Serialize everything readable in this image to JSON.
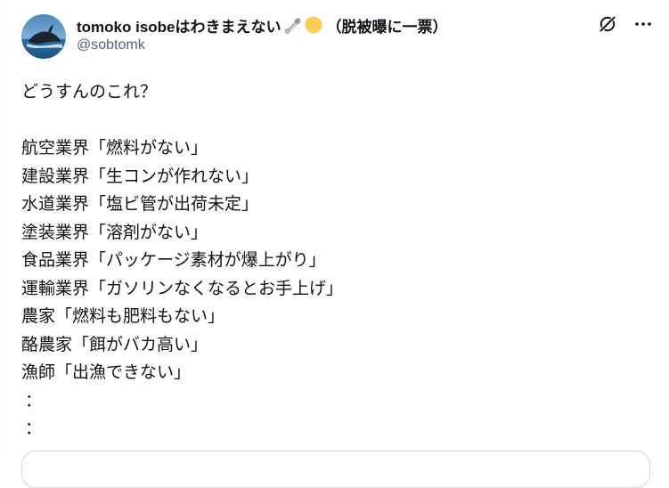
{
  "post": {
    "author": {
      "display_name": "tomoko isobeはわきまえない",
      "name_emojis": [
        "safety-pin-emoji",
        "yellow-circle-emoji"
      ],
      "name_suffix": "（脱被曝に一票）",
      "handle": "@sobtomk",
      "avatar": "whale-avatar"
    },
    "header_icons": [
      "grok-icon",
      "more-icon"
    ],
    "text_lines": [
      "どうすんのこれ？",
      "",
      "航空業界「燃料がない」",
      "建設業界「生コンが作れない」",
      "水道業界「塩ビ管が出荷未定」",
      "塗装業界「溶剤がない」",
      "食品業界「パッケージ素材が爆上がり」",
      "運輸業界「ガソリンなくなるとお手上げ」",
      "農家「燃料も肥料もない」",
      "酪農家「餌がバカ高い」",
      "漁師「出漁できない」",
      "：",
      "："
    ]
  },
  "colors": {
    "text": "#0f1419",
    "secondary": "#536471",
    "border": "#cfd9de"
  }
}
